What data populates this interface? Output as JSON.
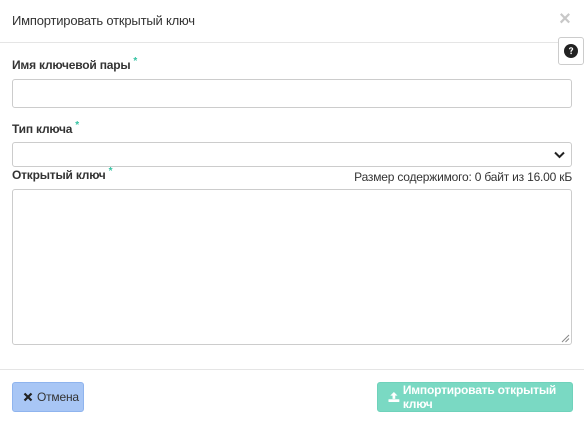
{
  "dialog": {
    "title": "Импортировать открытый ключ",
    "close_icon": "close-icon",
    "help_icon": "question-circle-icon"
  },
  "form": {
    "keypair_name": {
      "label": "Имя ключевой пары",
      "required_mark": "*",
      "value": ""
    },
    "key_type": {
      "label": "Тип ключа",
      "required_mark": "*",
      "selected": ""
    },
    "public_key": {
      "label": "Открытый ключ",
      "required_mark": "*",
      "value": "",
      "size_info": "Размер содержимого: 0 байт из 16.00 кБ"
    }
  },
  "footer": {
    "cancel_label": "Отмена",
    "cancel_icon": "times-icon",
    "submit_label": "Импортировать открытый ключ",
    "submit_icon": "upload-icon"
  },
  "colors": {
    "accent": "#35c3a3",
    "cancel_bg": "#a8c6f5",
    "submit_bg": "#7ad9c3"
  }
}
